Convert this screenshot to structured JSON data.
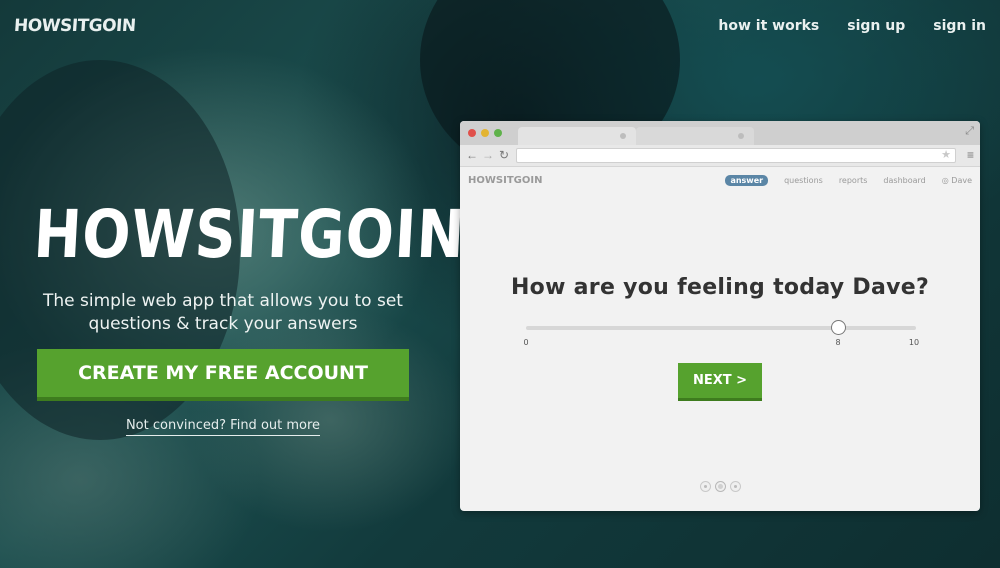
{
  "brand": {
    "logo": "HOWSITGOIN"
  },
  "nav": {
    "links": [
      "how it works",
      "sign up",
      "sign in"
    ]
  },
  "hero": {
    "title": "HOWSITGOIN",
    "subtitle": "The simple web app that allows you to set questions & track your answers",
    "cta_label": "CREATE MY FREE ACCOUNT",
    "more_link": "Not convinced? Find out more"
  },
  "mockup": {
    "app_logo": "HOWSITGOIN",
    "app_nav": [
      "answer",
      "questions",
      "reports",
      "dashboard"
    ],
    "user": "Dave",
    "question": "How are you feeling today Dave?",
    "slider": {
      "min": 0,
      "max": 10,
      "value": 8,
      "min_label": "0",
      "value_label": "8",
      "max_label": "10"
    },
    "next_label": "NEXT >",
    "pager": {
      "count": 3,
      "active": 1
    }
  },
  "colors": {
    "accent": "#56a22e",
    "accent_dark": "#3e7c1e",
    "nav_active": "#5b86a6"
  }
}
